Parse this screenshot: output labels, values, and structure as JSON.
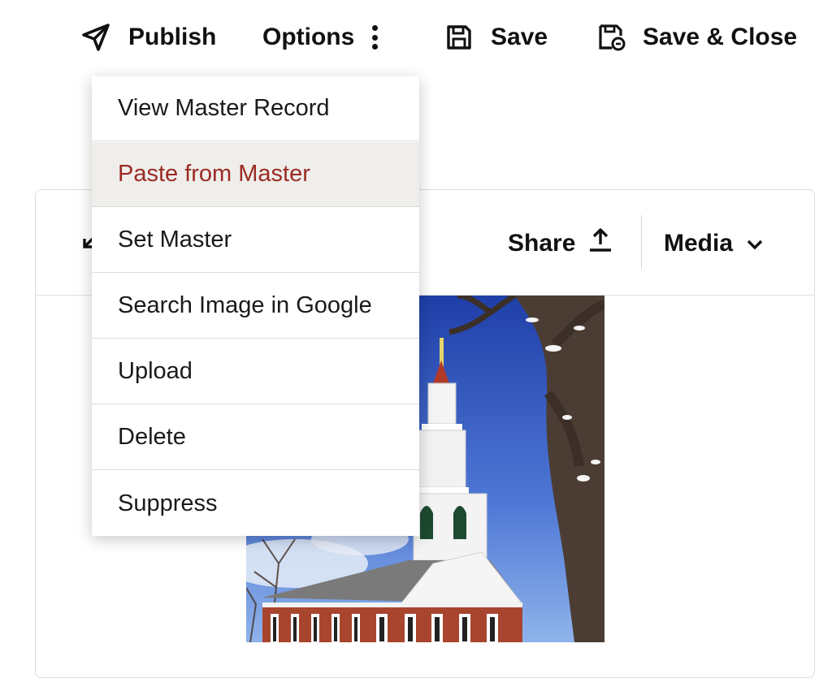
{
  "toolbar": {
    "publish_label": "Publish",
    "options_label": "Options",
    "save_label": "Save",
    "save_close_label": "Save & Close"
  },
  "card": {
    "share_label": "Share",
    "media_label": "Media"
  },
  "menu": {
    "items": [
      {
        "label": "View Master Record"
      },
      {
        "label": "Paste from Master",
        "highlighted": true
      },
      {
        "label": "Set Master"
      },
      {
        "label": "Search Image in Google"
      },
      {
        "label": "Upload"
      },
      {
        "label": "Delete"
      },
      {
        "label": "Suppress"
      }
    ]
  },
  "colors": {
    "highlight_bg": "#efeeeb",
    "highlight_text": "#9b2b24"
  },
  "icons": [
    "send-icon",
    "kebab-icon",
    "floppy-icon",
    "floppy-close-icon",
    "share-upload-icon",
    "chevron-down-icon",
    "collapse-arrow-icon"
  ]
}
